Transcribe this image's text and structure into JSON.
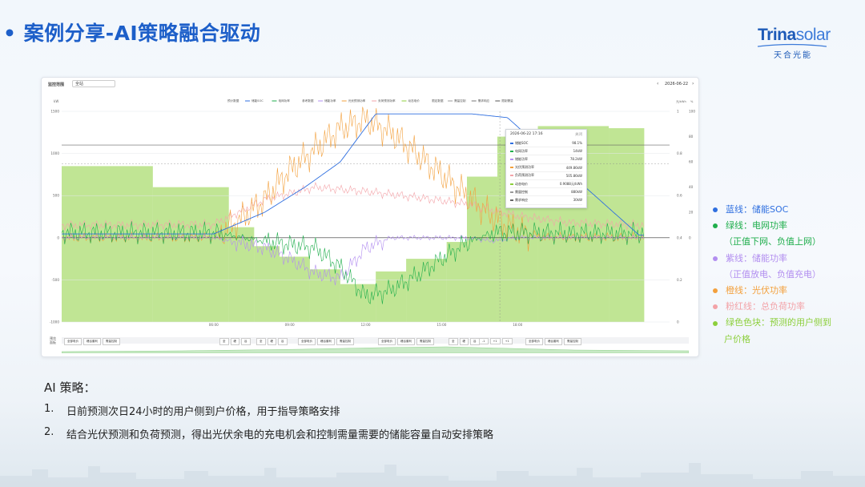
{
  "slide": {
    "bullet": "•",
    "title": "案例分享-AI策略融合驱动"
  },
  "logo": {
    "brand_main": "Trina",
    "brand_sub": "solar",
    "cn_name": "天合光能"
  },
  "panel": {
    "topbar_label": "监控范围",
    "topbar_select": "全站",
    "nav_prev": "‹",
    "nav_next": "›",
    "date": "2026-06-22",
    "chart_legend": [
      "储能SOC",
      "电网功率",
      "储能功率",
      "光伏预测功率",
      "负荷预测功率",
      "动态电价",
      "需量控制",
      "需求响应",
      "限制需量"
    ],
    "chart_legend_groups": [
      "预计数据",
      "参考数据",
      "限定数据"
    ],
    "colors": {
      "soc": "#2f6fe0",
      "grid": "#1fae4c",
      "storage": "#b28ef0",
      "pv": "#f3a03c",
      "load": "#f3a3a8",
      "price_area": "#8ccf3c"
    }
  },
  "tooltip": {
    "title": "2026-06-22 17:16",
    "close": "关闭",
    "rows": [
      {
        "key": "储能SOC",
        "value": "98.1%",
        "color": "#2f6fe0"
      },
      {
        "key": "电网功率",
        "value": "14kW",
        "color": "#1fae4c"
      },
      {
        "key": "储能功率",
        "value": "78.2kW",
        "color": "#b28ef0"
      },
      {
        "key": "光伏预测功率",
        "value": "449.86kW",
        "color": "#f3a03c"
      },
      {
        "key": "负荷预测功率",
        "value": "505.86kW",
        "color": "#f3a3a8"
      },
      {
        "key": "动态电价",
        "value": "0.9088元/kWh",
        "color": "#8ccf3c"
      },
      {
        "key": "需量控制",
        "value": "880kW",
        "color": "#999999"
      },
      {
        "key": "需求响应",
        "value": "30kW",
        "color": "#666666"
      }
    ]
  },
  "controls": {
    "side_label": "预览\n面板",
    "buttons": [
      "全部电价",
      "峰谷套利",
      "需量控制",
      "全",
      "峰",
      "谷",
      "全",
      "峰",
      "谷",
      "全部电价",
      "峰谷套利",
      "需量控制",
      "全部电价",
      "峰谷套利",
      "需量控制",
      "全",
      "峰",
      "谷",
      "-1",
      "+1",
      "+1",
      "全部电价",
      "峰谷套利",
      "需量控制"
    ]
  },
  "chart_data": {
    "type": "line",
    "y_left": {
      "ticks": [
        1500,
        1000,
        500,
        0,
        -500,
        -1000
      ],
      "unit": "kW",
      "ylim": [
        -1000,
        1500
      ]
    },
    "y_right_1": {
      "ticks": [
        1,
        0.8,
        0.6,
        0.4,
        0.2,
        0
      ],
      "unit": "元/kWh"
    },
    "y_right_2": {
      "ticks": [
        100,
        80,
        60,
        40,
        20,
        0
      ],
      "unit": "%"
    },
    "x_ticks": [
      "06:00",
      "09:00",
      "12:00",
      "15:00",
      "18:00"
    ],
    "price_blocks": [
      {
        "x0": 0,
        "x1": 3.6,
        "value": 0.74
      },
      {
        "x0": 3.6,
        "x1": 6.6,
        "value": 0.64
      },
      {
        "x0": 6.6,
        "x1": 7.6,
        "value": 0.45
      },
      {
        "x0": 7.6,
        "x1": 8.6,
        "value": 0.36
      },
      {
        "x0": 8.6,
        "x1": 9.8,
        "value": 0.31
      },
      {
        "x0": 9.8,
        "x1": 11.0,
        "value": 0.25
      },
      {
        "x0": 11.0,
        "x1": 12.4,
        "value": 0.18
      },
      {
        "x0": 12.4,
        "x1": 13.6,
        "value": 0.24
      },
      {
        "x0": 13.6,
        "x1": 15.2,
        "value": 0.3
      },
      {
        "x0": 15.2,
        "x1": 16.0,
        "value": 0.38
      },
      {
        "x0": 16.0,
        "x1": 17.2,
        "value": 0.69
      },
      {
        "x0": 17.2,
        "x1": 18.8,
        "value": 0.88
      },
      {
        "x0": 18.8,
        "x1": 21.6,
        "value": 0.93
      },
      {
        "x0": 21.6,
        "x1": 23.0,
        "value": 0.92
      }
    ],
    "series": [
      {
        "name": "储能SOC",
        "points": [
          [
            0,
            3
          ],
          [
            6,
            3
          ],
          [
            8,
            20
          ],
          [
            9.6,
            40
          ],
          [
            11,
            60
          ],
          [
            12.4,
            98
          ],
          [
            14.6,
            98
          ],
          [
            16.2,
            98
          ],
          [
            17.6,
            95
          ],
          [
            22.8,
            2
          ]
        ]
      },
      {
        "name": "光伏预测功率",
        "points": [
          [
            0,
            0
          ],
          [
            6,
            0
          ],
          [
            7,
            200
          ],
          [
            8,
            450
          ],
          [
            9,
            800
          ],
          [
            10,
            1050
          ],
          [
            11,
            1300
          ],
          [
            12,
            1400
          ],
          [
            13,
            1250
          ],
          [
            14,
            1000
          ],
          [
            15,
            750
          ],
          [
            16,
            500
          ],
          [
            17,
            250
          ],
          [
            18,
            80
          ],
          [
            19,
            0
          ],
          [
            23,
            0
          ]
        ]
      },
      {
        "name": "负荷预测功率",
        "points": [
          [
            0,
            150
          ],
          [
            6,
            160
          ],
          [
            8,
            450
          ],
          [
            10,
            600
          ],
          [
            12,
            550
          ],
          [
            14,
            480
          ],
          [
            16,
            400
          ],
          [
            18,
            260
          ],
          [
            20,
            180
          ],
          [
            23,
            150
          ]
        ]
      },
      {
        "name": "电网功率",
        "points": [
          [
            0,
            60
          ],
          [
            6,
            60
          ],
          [
            8,
            -40
          ],
          [
            10,
            -120
          ],
          [
            11,
            -350
          ],
          [
            12,
            -700
          ],
          [
            13,
            -620
          ],
          [
            14,
            -450
          ],
          [
            15,
            -250
          ],
          [
            16,
            -60
          ],
          [
            17,
            60
          ],
          [
            23,
            50
          ]
        ]
      },
      {
        "name": "储能功率",
        "points": [
          [
            0,
            0
          ],
          [
            6,
            0
          ],
          [
            7,
            -60
          ],
          [
            8,
            -120
          ],
          [
            9,
            -250
          ],
          [
            10,
            -420
          ],
          [
            11,
            -480
          ],
          [
            12,
            -120
          ],
          [
            13,
            0
          ],
          [
            16,
            0
          ],
          [
            17,
            -40
          ],
          [
            18,
            0
          ],
          [
            23,
            0
          ]
        ]
      }
    ]
  },
  "side_legend": [
    {
      "text": "蓝线：储能SOC",
      "color": "#2f6fe0"
    },
    {
      "text": "绿线：电网功率",
      "color": "#1fae4c"
    },
    {
      "text": "（正值下网、负值上网）",
      "color": ""
    },
    {
      "text": "紫线：储能功率",
      "color": "#b28ef0"
    },
    {
      "text": "（正值放电、负值充电）",
      "color": ""
    },
    {
      "text": "橙线：光伏功率",
      "color": "#f3a03c"
    },
    {
      "text": "粉红线：总负荷功率",
      "color": "#f3a3a8"
    },
    {
      "text": "绿色色块：预测的用户侧到",
      "color": "#8ccf3c"
    },
    {
      "text": "户价格",
      "color": ""
    }
  ],
  "strategy": {
    "title": "AI 策略：",
    "items": [
      {
        "num": "1.",
        "text": "日前预测次日24小时的用户侧到户价格，用于指导策略安排"
      },
      {
        "num": "2.",
        "text": "结合光伏预测和负荷预测，得出光伏余电的充电机会和控制需量需要的储能容量自动安排策略"
      }
    ]
  }
}
